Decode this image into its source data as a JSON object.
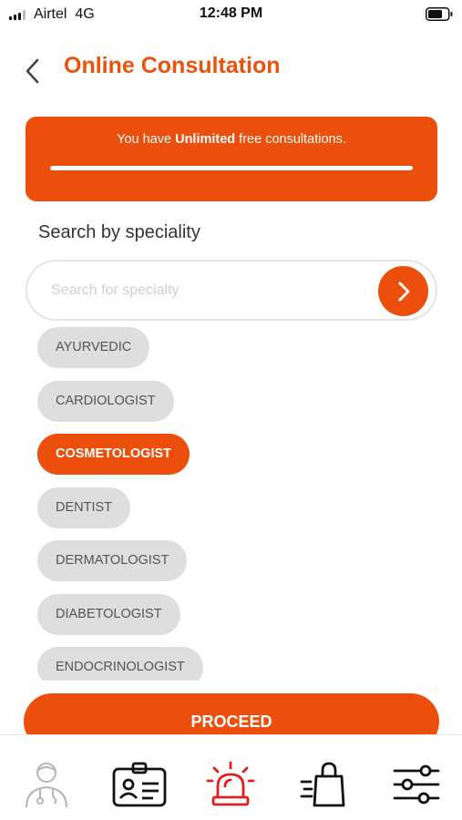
{
  "status_bar": {
    "carrier": "Airtel",
    "network": "4G",
    "time": "12:48 PM"
  },
  "header": {
    "title": "Online Consultation",
    "back_icon": "chevron-left-icon"
  },
  "banner": {
    "text_prefix": "You have ",
    "text_bold": "Unlimited",
    "text_suffix": " free consultations.",
    "progress": 1.0
  },
  "search": {
    "label": "Search by speciality",
    "placeholder": "Search for specialty",
    "value": "",
    "go_icon": "chevron-right-icon"
  },
  "specialities": [
    {
      "label": "AYURVEDIC",
      "selected": false
    },
    {
      "label": "CARDIOLOGIST",
      "selected": false
    },
    {
      "label": "COSMETOLOGIST",
      "selected": true
    },
    {
      "label": "DENTIST",
      "selected": false
    },
    {
      "label": "DERMATOLOGIST",
      "selected": false
    },
    {
      "label": "DIABETOLOGIST",
      "selected": false
    },
    {
      "label": "ENDOCRINOLOGIST",
      "selected": false
    }
  ],
  "proceed_label": "PROCEED",
  "tabs": [
    {
      "icon": "doctor-icon",
      "active": false
    },
    {
      "icon": "id-card-icon",
      "active": false
    },
    {
      "icon": "emergency-siren-icon",
      "active": true
    },
    {
      "icon": "shopping-bag-icon",
      "active": false
    },
    {
      "icon": "settings-sliders-icon",
      "active": false
    }
  ],
  "colors": {
    "accent": "#ec4e0b",
    "chip": "#dedede",
    "emergency": "#e01e1e"
  }
}
